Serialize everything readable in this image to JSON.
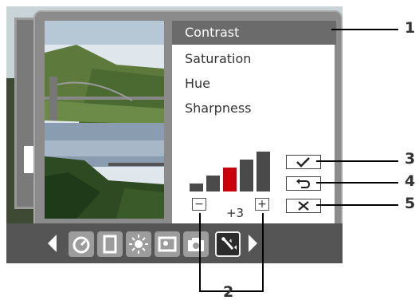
{
  "menu": {
    "items": [
      {
        "label": "Contrast",
        "selected": true
      },
      {
        "label": "Saturation",
        "selected": false
      },
      {
        "label": "Hue",
        "selected": false
      },
      {
        "label": "Sharpness",
        "selected": false
      }
    ]
  },
  "adjust": {
    "value": "+3",
    "minus": "−",
    "plus": "+",
    "level_count": 5,
    "active_level": 3
  },
  "actions": {
    "confirm_icon": "checkmark-icon",
    "reset_icon": "undo-icon",
    "cancel_icon": "close-x-icon"
  },
  "toolbar": {
    "icons": [
      "timer-icon",
      "clipboard-icon",
      "brightness-icon",
      "image-settings-icon",
      "camera-icon",
      "tools-icon"
    ],
    "selected": "tools-icon"
  },
  "callouts": [
    "1",
    "2",
    "3",
    "4",
    "5"
  ],
  "colors": {
    "active_bar": "#c8000d",
    "menu_selected_bg": "#6b6b6b"
  }
}
